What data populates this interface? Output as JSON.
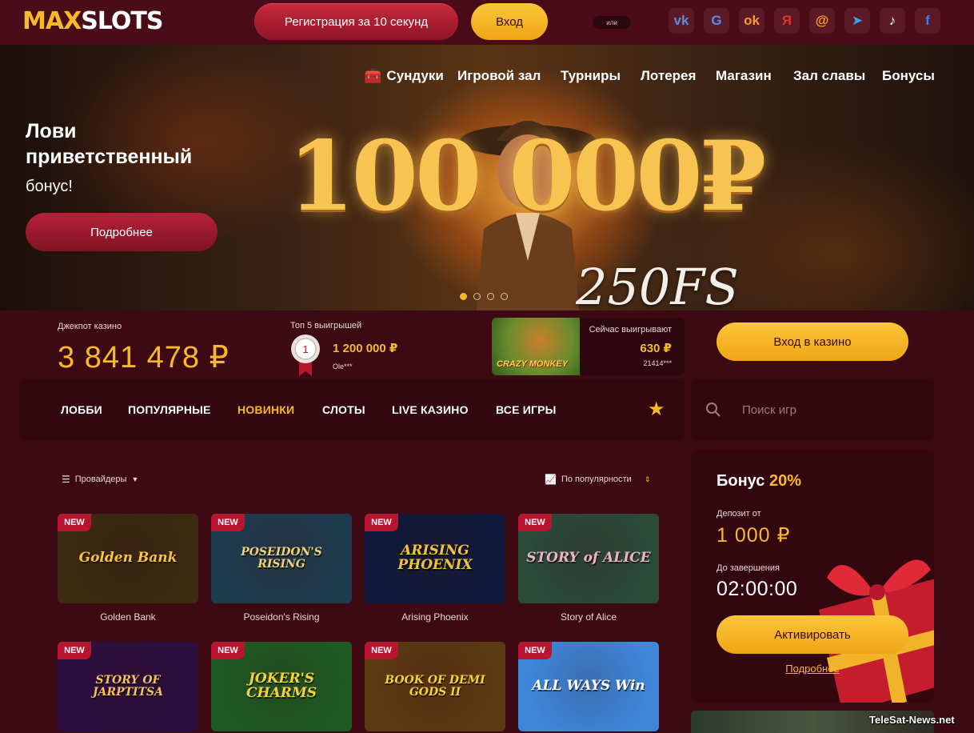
{
  "header": {
    "logo_max": "MAX",
    "logo_slots": "SLOTS",
    "register_label": "Регистрация за 10 секунд",
    "login_label": "Вход",
    "or_label": "или",
    "socials": [
      {
        "icon": "vk-icon",
        "glyph": "vk",
        "color": "#5a8fd6"
      },
      {
        "icon": "google-icon",
        "glyph": "G",
        "color": "#4f8ef7"
      },
      {
        "icon": "odnoklassniki-icon",
        "glyph": "ok",
        "color": "#f59b21"
      },
      {
        "icon": "yandex-icon",
        "glyph": "Я",
        "color": "#e0332c"
      },
      {
        "icon": "mailru-icon",
        "glyph": "@",
        "color": "#f6a623"
      },
      {
        "icon": "telegram-icon",
        "glyph": "➤",
        "color": "#35a5e4"
      },
      {
        "icon": "tiktok-icon",
        "glyph": "♪",
        "color": "#ffffff"
      },
      {
        "icon": "facebook-icon",
        "glyph": "f",
        "color": "#3d7bf0"
      }
    ]
  },
  "nav": {
    "chests": "Сундуки",
    "game_hall": "Игровой зал",
    "tournaments": "Турниры",
    "lottery": "Лотерея",
    "shop": "Магазин",
    "hall_of_fame": "Зал славы",
    "bonuses": "Бонусы"
  },
  "hero": {
    "title": "Лови приветственный",
    "subtitle": "бонус!",
    "button": "Подробнее",
    "amount": "100 000₽",
    "freespins": "250FS",
    "slide_count": 4,
    "active_slide": 1
  },
  "stats": {
    "jackpot_label": "Джекпот казино",
    "jackpot_value": "3 841 478 ₽",
    "top5_label": "Топ 5 выигрышей",
    "top5_rank": "1",
    "top5_amount": "1 200 000 ₽",
    "top5_user": "Ole***",
    "now_winning_label": "Сейчас выигрывают",
    "now_game": "CRAZY MONKEY",
    "now_amount": "630 ₽",
    "now_user": "21414***",
    "casino_button": "Вход в казино"
  },
  "categories": {
    "lobby": "ЛОББИ",
    "popular": "ПОПУЛЯРНЫЕ",
    "new": "НОВИНКИ",
    "slots": "СЛОТЫ",
    "live": "LIVE КАЗИНО",
    "all": "ВСЕ ИГРЫ",
    "active": "new"
  },
  "search": {
    "placeholder": "Поиск игр"
  },
  "filters": {
    "providers": "Провайдеры",
    "sort": "По популярности"
  },
  "games_badge": "NEW",
  "games": [
    {
      "name": "Golden Bank",
      "art": "Golden Bank",
      "bg": "#3a2a10",
      "fg": "#f6c636"
    },
    {
      "name": "Poseidon's Rising",
      "art": "POSEIDON'S RISING",
      "bg": "#1e3b4e",
      "fg": "#f0d27a"
    },
    {
      "name": "Arising Phoenix",
      "art": "ARISING PHOENIX",
      "bg": "#0f1a3a",
      "fg": "#f0c43a"
    },
    {
      "name": "Story of Alice",
      "art": "STORY of ALICE",
      "bg": "#2a4a3a",
      "fg": "#f0b0c8"
    },
    {
      "name": "",
      "art": "STORY OF JARPTITSA",
      "bg": "#2b0f3e",
      "fg": "#f4c060"
    },
    {
      "name": "",
      "art": "JOKER'S CHARMS",
      "bg": "#1e5a23",
      "fg": "#f6d23a"
    },
    {
      "name": "",
      "art": "BOOK OF DEMI GODS II",
      "bg": "#5a3a12",
      "fg": "#f6d23a"
    },
    {
      "name": "",
      "art": "ALL WAYS Win",
      "bg": "#3d86d8",
      "fg": "#ffffff"
    }
  ],
  "bonus": {
    "title": "Бонус",
    "percent": "20%",
    "deposit_label": "Депозит от",
    "deposit_value": "1 000 ₽",
    "end_label": "До завершения",
    "timer": "02:00:00",
    "activate": "Активировать",
    "more_link": "Подробнее"
  },
  "watermark": "TeleSat-News.net"
}
